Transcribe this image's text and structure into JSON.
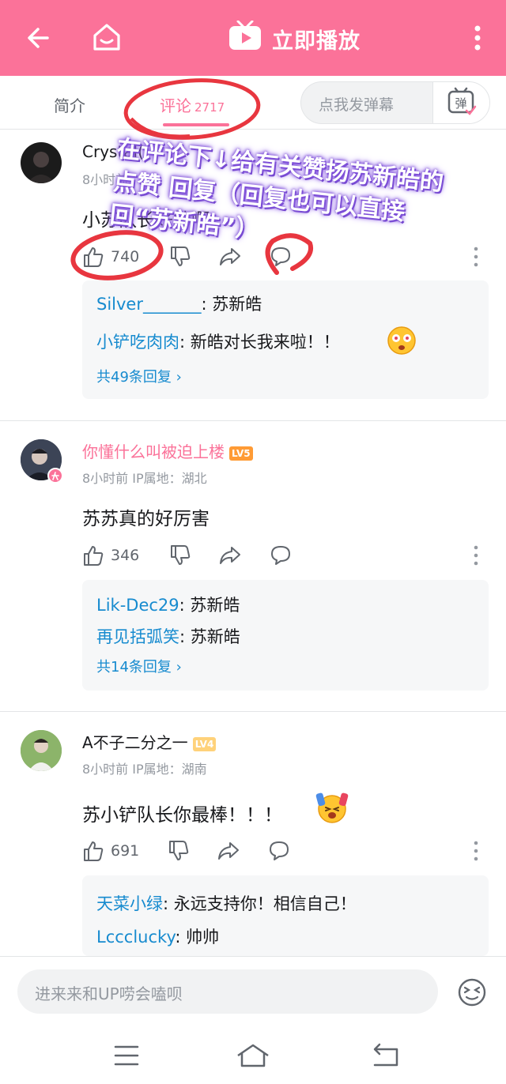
{
  "header": {
    "title": "立即播放",
    "bg_color": "#fb7299"
  },
  "tabs": {
    "intro": "简介",
    "comments": "评论",
    "comments_count": "2717",
    "danmaku_placeholder": "点我发弹幕",
    "danmaku_button": "弹"
  },
  "annotation_note": "在评论下↓给有关赞扬苏新皓的点赞 回复（回复也可以直接回“苏新皓”）",
  "comments": [
    {
      "username": "Crystal(",
      "meta": "8小时前",
      "text": "小苏队长好棒啊",
      "likes": "740",
      "replies": [
        {
          "name": "Silver_______",
          "text": ": 苏新皓"
        },
        {
          "name": "小铲吃肉肉",
          "text": ": 新皓对长我来啦！！"
        }
      ],
      "more": "共49条回复 ›"
    },
    {
      "username": "你懂什么叫被迫上楼",
      "level": "LV5",
      "meta": "8小时前   IP属地：湖北",
      "text": "苏苏真的好厉害",
      "likes": "346",
      "replies": [
        {
          "name": "Lik-Dec29",
          "text": ": 苏新皓"
        },
        {
          "name": "再见括弧笑",
          "text": ": 苏新皓"
        }
      ],
      "more": "共14条回复 ›"
    },
    {
      "username": "A不子二分之一",
      "level": "LV4",
      "meta": "8小时前   IP属地：湖南",
      "text": "苏小铲队长你最棒！！！",
      "likes": "691",
      "replies": [
        {
          "name": "天菜小绿",
          "text": ": 永远支持你！相信自己！"
        },
        {
          "name": "Lccclucky",
          "text": ": 帅帅"
        }
      ]
    }
  ],
  "bottom": {
    "input_placeholder": "进来来和UP唠会嗑呗"
  }
}
